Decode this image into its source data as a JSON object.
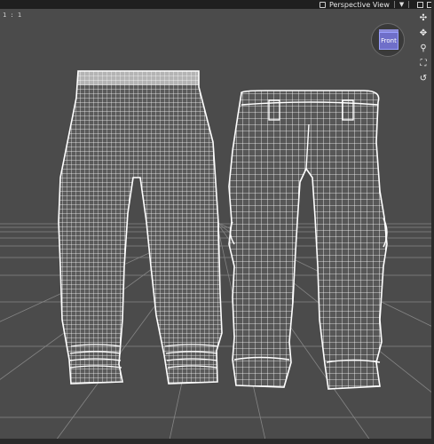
{
  "viewport": {
    "camera_label": "Perspective View",
    "ratio_label": "1 : 1",
    "nav_cube_face": "Front",
    "background_color": "#4b4b4b",
    "wire_color": "#ffffff",
    "grid_color": "#8c8c8c"
  },
  "toolbar_icons": [
    "camera-icon",
    "dropdown-arrow-icon",
    "layout-icon",
    "maximize-icon"
  ],
  "tools": [
    {
      "name": "rotate-icon",
      "glyph": "✣"
    },
    {
      "name": "pan-icon",
      "glyph": "✥"
    },
    {
      "name": "zoom-icon",
      "glyph": "⚲"
    },
    {
      "name": "frame-icon",
      "glyph": "⛶"
    },
    {
      "name": "reset-view-icon",
      "glyph": "↺"
    }
  ]
}
